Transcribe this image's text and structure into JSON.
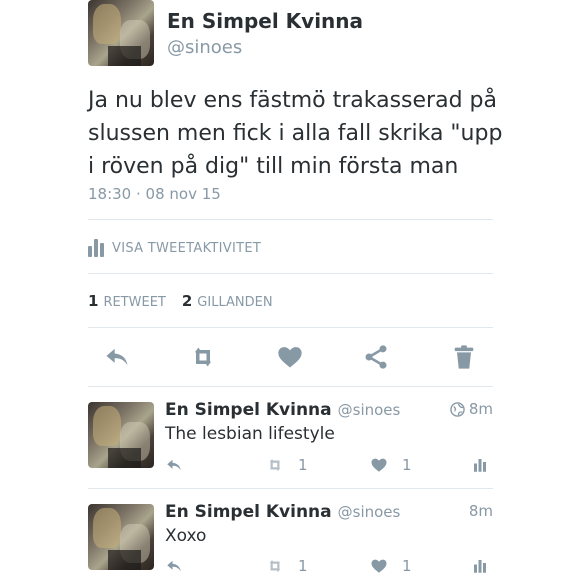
{
  "tweet": {
    "author_name": "En Simpel Kvinna",
    "author_handle": "@sinoes",
    "text": "Ja nu blev ens fästmö trakasserad på slussen men fick i alla fall skrika \"upp i röven på dig\" till min första man",
    "timestamp": "18:30 · 08 nov 15",
    "activity_label": "VISA TWEETAKTIVITET",
    "retweets_count": "1",
    "retweets_label": "RETWEET",
    "likes_count": "2",
    "likes_label": "GILLANDEN"
  },
  "actions": [
    "reply-icon",
    "retweet-icon",
    "heart-icon",
    "share-icon",
    "trash-icon"
  ],
  "replies": [
    {
      "author_name": "En Simpel Kvinna",
      "author_handle": "@sinoes",
      "text": "The lesbian lifestyle",
      "time": "8m",
      "has_globe": true,
      "retweets": "1",
      "likes": "1"
    },
    {
      "author_name": "En Simpel Kvinna",
      "author_handle": "@sinoes",
      "text": "Xoxo",
      "time": "8m",
      "has_globe": false,
      "retweets": "1",
      "likes": "1"
    }
  ],
  "colors": {
    "text": "#292f33",
    "muted": "#8899a6",
    "divider": "#e1e8ed"
  }
}
